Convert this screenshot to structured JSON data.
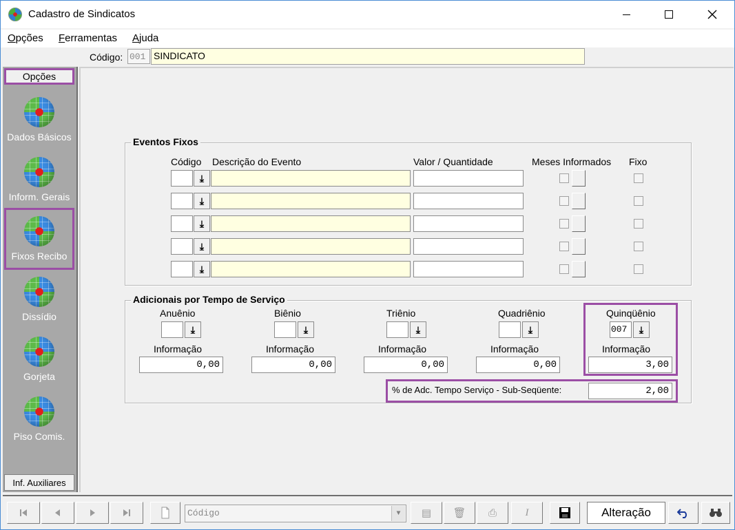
{
  "window": {
    "title": "Cadastro de Sindicatos"
  },
  "menu": {
    "items": [
      "Opções",
      "Ferramentas",
      "Ajuda"
    ],
    "underline": [
      "O",
      "F",
      "A"
    ],
    "rest": [
      "pções",
      "erramentas",
      "juda"
    ]
  },
  "code_row": {
    "label": "Código:",
    "number": "001",
    "name": "SINDICATO"
  },
  "sidebar": {
    "header": "Opções",
    "items": [
      {
        "label": "Dados Básicos",
        "icon": "globe-icon"
      },
      {
        "label": "Inform. Gerais",
        "icon": "globe-icon"
      },
      {
        "label": "Fixos Recibo",
        "icon": "globe-icon"
      },
      {
        "label": "Dissídio",
        "icon": "globe-icon"
      },
      {
        "label": "Gorjeta",
        "icon": "globe-icon"
      },
      {
        "label": "Piso Comis.",
        "icon": "globe-icon"
      }
    ],
    "footer": "Inf. Auxiliares"
  },
  "eventos": {
    "title": "Eventos Fixos",
    "headers": {
      "codigo": "Código",
      "descricao": "Descrição do Evento",
      "valor": "Valor / Quantidade",
      "meses": "Meses Informados",
      "fixo": "Fixo"
    }
  },
  "adicionais": {
    "title": "Adicionais por Tempo de Serviço",
    "periods": [
      {
        "label": "Anuênio",
        "code": "",
        "info_label": "Informação",
        "value": "0,00"
      },
      {
        "label": "Biênio",
        "code": "",
        "info_label": "Informação",
        "value": "0,00"
      },
      {
        "label": "Triênio",
        "code": "",
        "info_label": "Informação",
        "value": "0,00"
      },
      {
        "label": "Quadriênio",
        "code": "",
        "info_label": "Informação",
        "value": "0,00"
      },
      {
        "label": "Quinqüênio",
        "code": "007",
        "info_label": "Informação",
        "value": "3,00"
      }
    ],
    "subsequent_label": "% de Adc. Tempo Serviço - Sub-Seqüente:",
    "subsequent_value": "2,00"
  },
  "toolbar": {
    "search_placeholder": "Código",
    "status": "Alteração"
  },
  "colors": {
    "highlight": "#9b4ea5",
    "input_yellow": "#ffffe1",
    "sidebar": "#a8a8a8"
  }
}
